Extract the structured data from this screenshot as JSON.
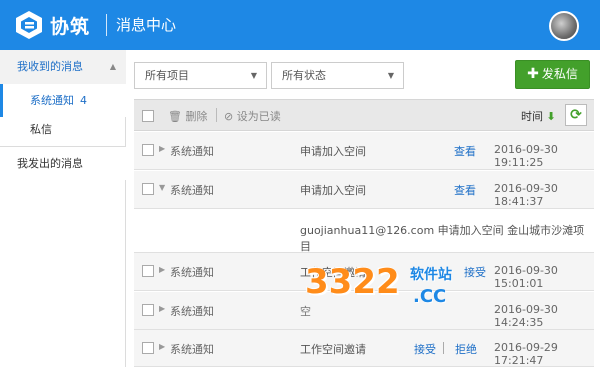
{
  "header": {
    "brand": "协筑",
    "section_title": "消息中心"
  },
  "sidebar": {
    "received_label": "我收到的消息",
    "items": [
      {
        "label": "系统通知",
        "count": "4"
      },
      {
        "label": "私信"
      }
    ],
    "sent_label": "我发出的消息"
  },
  "filters": {
    "project_value": "所有项目",
    "status_value": "所有状态"
  },
  "new_button_label": "发私信",
  "toolbar": {
    "delete_label": "删除",
    "mark_read_label": "设为已读",
    "time_label": "时间"
  },
  "rows": [
    {
      "type": "系统通知",
      "subject": "申请加入空间",
      "action": "查看",
      "date": "2016-09-30 19:11:25"
    },
    {
      "type": "系统通知",
      "subject": "申请加入空间",
      "action": "查看",
      "date": "2016-09-30 18:41:37"
    },
    {
      "type": "系统通知",
      "subject": "工作空间邀请",
      "action": "接受",
      "date": "2016-09-30 15:01:01"
    },
    {
      "type": "系统通知",
      "subject": "空",
      "date": "2016-09-30 14:24:35"
    },
    {
      "type": "系统通知",
      "subject": "工作空间邀请",
      "action": "接受",
      "action2": "拒绝",
      "date": "2016-09-29 17:21:47"
    }
  ],
  "expanded_detail": "guojianhua11@126.com 申请加入空间 金山城市沙滩项目",
  "watermark": {
    "number": "3322",
    "site": "软件站",
    "domain": ".CC"
  }
}
